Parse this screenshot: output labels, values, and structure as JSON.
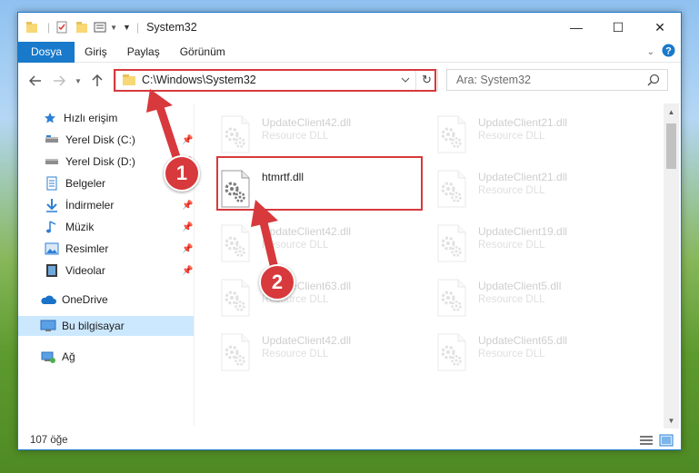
{
  "window": {
    "title": "System32",
    "controls": {
      "minimize": "—",
      "maximize": "☐",
      "close": "✕"
    }
  },
  "ribbon": {
    "tabs": [
      {
        "label": "Dosya",
        "active": true
      },
      {
        "label": "Giriş"
      },
      {
        "label": "Paylaş"
      },
      {
        "label": "Görünüm"
      }
    ]
  },
  "address": {
    "path": "C:\\Windows\\System32",
    "search_placeholder": "Ara: System32"
  },
  "sidebar": {
    "items": [
      {
        "label": "Hızlı erişim",
        "icon": "star-icon"
      },
      {
        "label": "Yerel Disk (C:)",
        "icon": "drive-icon",
        "pinned": true
      },
      {
        "label": "Yerel Disk (D:)",
        "icon": "drive-icon",
        "pinned": true
      },
      {
        "label": "Belgeler",
        "icon": "document-icon",
        "pinned": true
      },
      {
        "label": "İndirmeler",
        "icon": "download-icon",
        "pinned": true
      },
      {
        "label": "Müzik",
        "icon": "music-icon",
        "pinned": true
      },
      {
        "label": "Resimler",
        "icon": "pictures-icon",
        "pinned": true
      },
      {
        "label": "Videolar",
        "icon": "video-icon",
        "pinned": true
      },
      {
        "label": "OneDrive",
        "icon": "cloud-icon"
      },
      {
        "label": "Bu bilgisayar",
        "icon": "computer-icon",
        "selected": true
      },
      {
        "label": "Ağ",
        "icon": "network-icon"
      }
    ]
  },
  "files": [
    {
      "name": "UpdateClient42.dll",
      "type": "Resource DLL"
    },
    {
      "name": "UpdateClient21.dll",
      "type": "Resource DLL"
    },
    {
      "name": "htmrtf.dll",
      "type": "",
      "highlight": true
    },
    {
      "name": "UpdateClient21.dll",
      "type": "Resource DLL"
    },
    {
      "name": "UpdateClient42.dll",
      "type": "Resource DLL"
    },
    {
      "name": "UpdateClient19.dll",
      "type": "Resource DLL"
    },
    {
      "name": "UpdateClient63.dll",
      "type": "Resource DLL"
    },
    {
      "name": "UpdateClient5.dll",
      "type": "Resource DLL"
    },
    {
      "name": "UpdateClient42.dll",
      "type": "Resource DLL"
    },
    {
      "name": "UpdateClient65.dll",
      "type": "Resource DLL"
    }
  ],
  "status": {
    "item_count": "107 öğe"
  },
  "annotations": {
    "step1": "1",
    "step2": "2"
  },
  "colors": {
    "accent": "#1979ca",
    "annotation": "#d7393c"
  }
}
